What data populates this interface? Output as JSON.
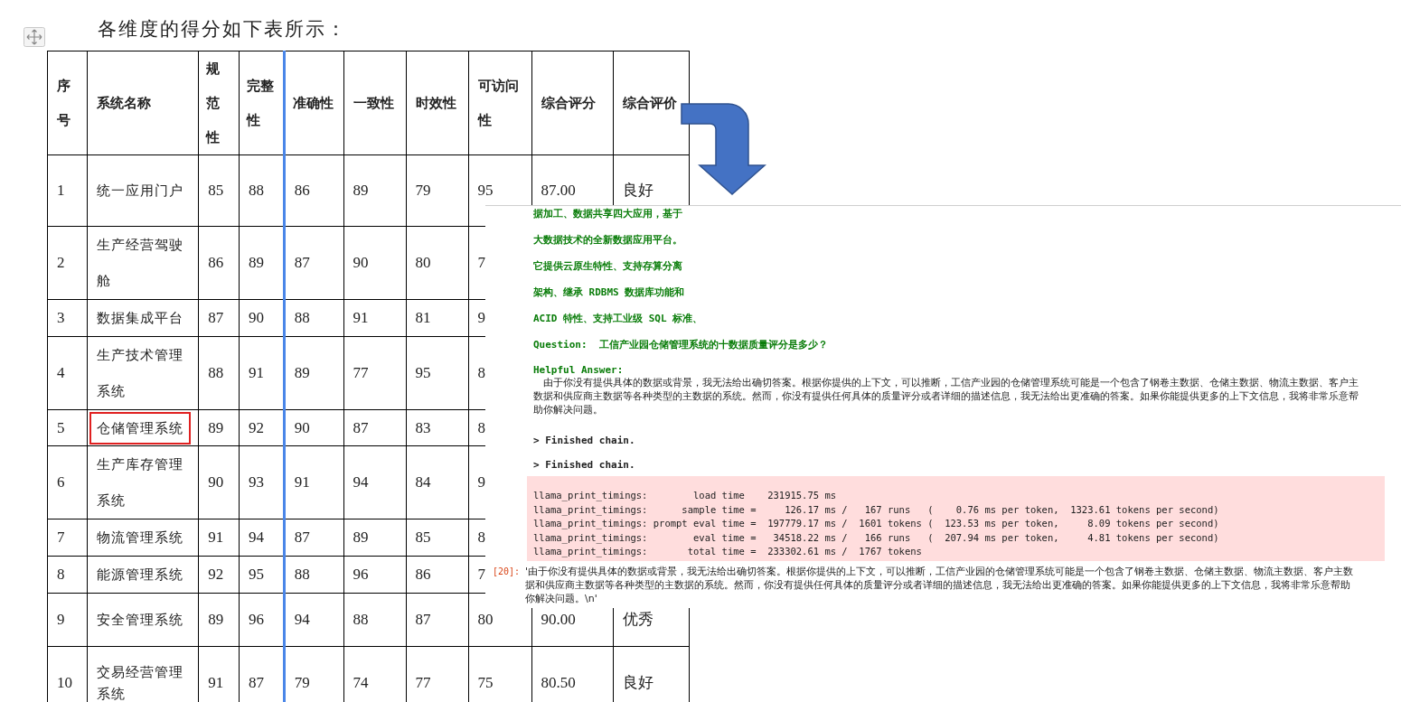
{
  "heading": "各维度的得分如下表所示：",
  "table": {
    "columns": [
      "序号",
      "系统名称",
      "规范性",
      "完整性",
      "准确性",
      "一致性",
      "时效性",
      "可访问性",
      "综合评分",
      "综合评价"
    ],
    "rows": [
      {
        "cells": [
          "1",
          "统一应用门户",
          "85",
          "88",
          "86",
          "89",
          "79",
          "95",
          "87.00",
          "良好"
        ],
        "highlighted": false
      },
      {
        "cells": [
          "2",
          "生产经营驾驶舱",
          "86",
          "89",
          "87",
          "90",
          "80",
          "7"
        ],
        "highlighted": false
      },
      {
        "cells": [
          "3",
          "数据集成平台",
          "87",
          "90",
          "88",
          "91",
          "81",
          "9"
        ],
        "highlighted": false
      },
      {
        "cells": [
          "4",
          "生产技术管理系统",
          "88",
          "91",
          "89",
          "77",
          "95",
          "8"
        ],
        "highlighted": false
      },
      {
        "cells": [
          "5",
          "仓储管理系统",
          "89",
          "92",
          "90",
          "87",
          "83",
          "8"
        ],
        "highlighted": true
      },
      {
        "cells": [
          "6",
          "生产库存管理系统",
          "90",
          "93",
          "91",
          "94",
          "84",
          "9"
        ],
        "highlighted": false
      },
      {
        "cells": [
          "7",
          "物流管理系统",
          "91",
          "94",
          "87",
          "89",
          "85",
          "8"
        ],
        "highlighted": false
      },
      {
        "cells": [
          "8",
          "能源管理系统",
          "92",
          "95",
          "88",
          "96",
          "86",
          "7"
        ],
        "highlighted": false
      },
      {
        "cells": [
          "9",
          "安全管理系统",
          "89",
          "96",
          "94",
          "88",
          "87",
          "80",
          "90.00",
          "优秀"
        ],
        "highlighted": false
      },
      {
        "cells": [
          "10",
          "交易经营管理系统",
          "91",
          "87",
          "79",
          "74",
          "77",
          "75",
          "80.50",
          "良好"
        ],
        "highlighted": false
      }
    ]
  },
  "console": {
    "lines": [
      {
        "kind": "context",
        "text": "据加工、数据共享四大应用，基于"
      },
      {
        "kind": "context",
        "text": "大数据技术的全新数据应用平台。"
      },
      {
        "kind": "context",
        "text": "它提供云原生特性、支持存算分离"
      },
      {
        "kind": "context",
        "text": "架构、继承 RDBMS 数据库功能和"
      },
      {
        "kind": "context",
        "text": "ACID 特性、支持工业级 SQL 标准、"
      },
      {
        "kind": "context",
        "text": "Question:  工信产业园仓储管理系统的十数据质量评分是多少？"
      },
      {
        "kind": "label",
        "text": "Helpful Answer:"
      },
      {
        "kind": "answer",
        "text": "由于你没有提供具体的数据或背景，我无法给出确切答案。根据你提供的上下文，可以推断，工信产业园的仓储管理系统可能是一个包含了钢卷主数据、仓储主数据、物流主数据、客户主数据和供应商主数据等各种类型的主数据的系统。然而，你没有提供任何具体的质量评分或者详细的描述信息，我无法给出更准确的答案。如果你能提供更多的上下文信息，我将非常乐意帮助你解决问题。"
      },
      {
        "kind": "status",
        "text": "> Finished chain."
      },
      {
        "kind": "status",
        "text": "> Finished chain."
      }
    ],
    "stderr": [
      "llama_print_timings:        load time    231915.75 ms",
      "llama_print_timings:      sample time =     126.17 ms /   167 runs   (    0.76 ms per token,  1323.61 tokens per second)",
      "llama_print_timings: prompt eval time =  197779.17 ms /  1601 tokens (  123.53 ms per token,     8.09 tokens per second)",
      "llama_print_timings:        eval time =   34518.22 ms /   166 runs   (  207.94 ms per token,     4.81 tokens per second)",
      "llama_print_timings:       total time =  233302.61 ms /  1767 tokens"
    ],
    "prompt": "[20]:",
    "output": "'由于你没有提供具体的数据或背景，我无法给出确切答案。根据你提供的上下文，可以推断，工信产业园的仓储管理系统可能是一个包含了钢卷主数据、仓储主数据、物流主数据、客户主数据和供应商主数据等各种类型的主数据的系统。然而，你没有提供任何具体的质量评分或者详细的描述信息，我无法给出更准确的答案。如果你能提供更多的上下文信息，我将非常乐意帮助你解决问题。\\n'"
  }
}
